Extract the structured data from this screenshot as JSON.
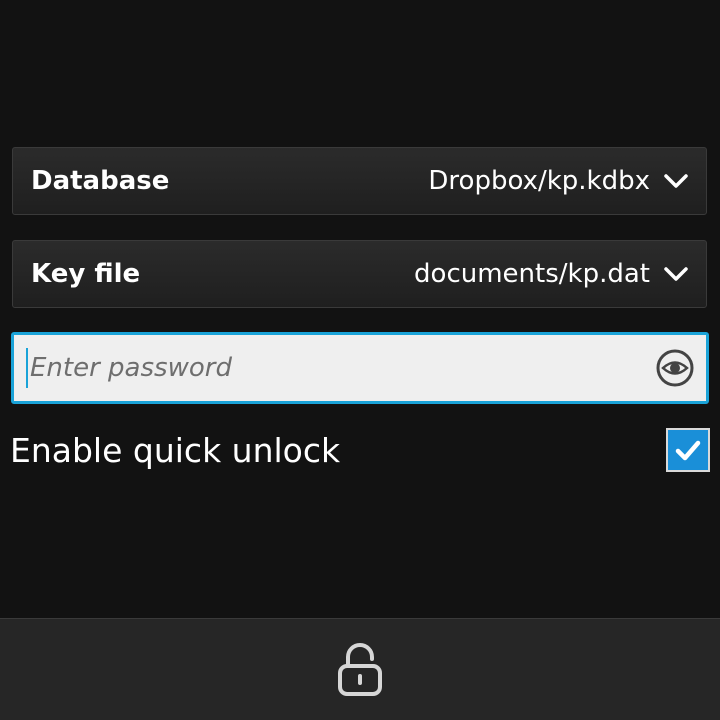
{
  "database": {
    "label": "Database",
    "value": "Dropbox/kp.kdbx",
    "icon": "chevron-down-icon"
  },
  "key_file": {
    "label": "Key file",
    "value": "documents/kp.dat",
    "icon": "chevron-down-icon"
  },
  "password": {
    "value": "",
    "placeholder": "Enter password",
    "toggle_icon": "eye-icon"
  },
  "quick_unlock": {
    "label": "Enable quick unlock",
    "checked": true,
    "icon": "checkmark-icon"
  },
  "action_bar": {
    "unlock_icon": "unlock-icon"
  },
  "colors": {
    "accent": "#1aa3d8",
    "checkbox_fill": "#1a8fd8",
    "background": "#121212"
  }
}
